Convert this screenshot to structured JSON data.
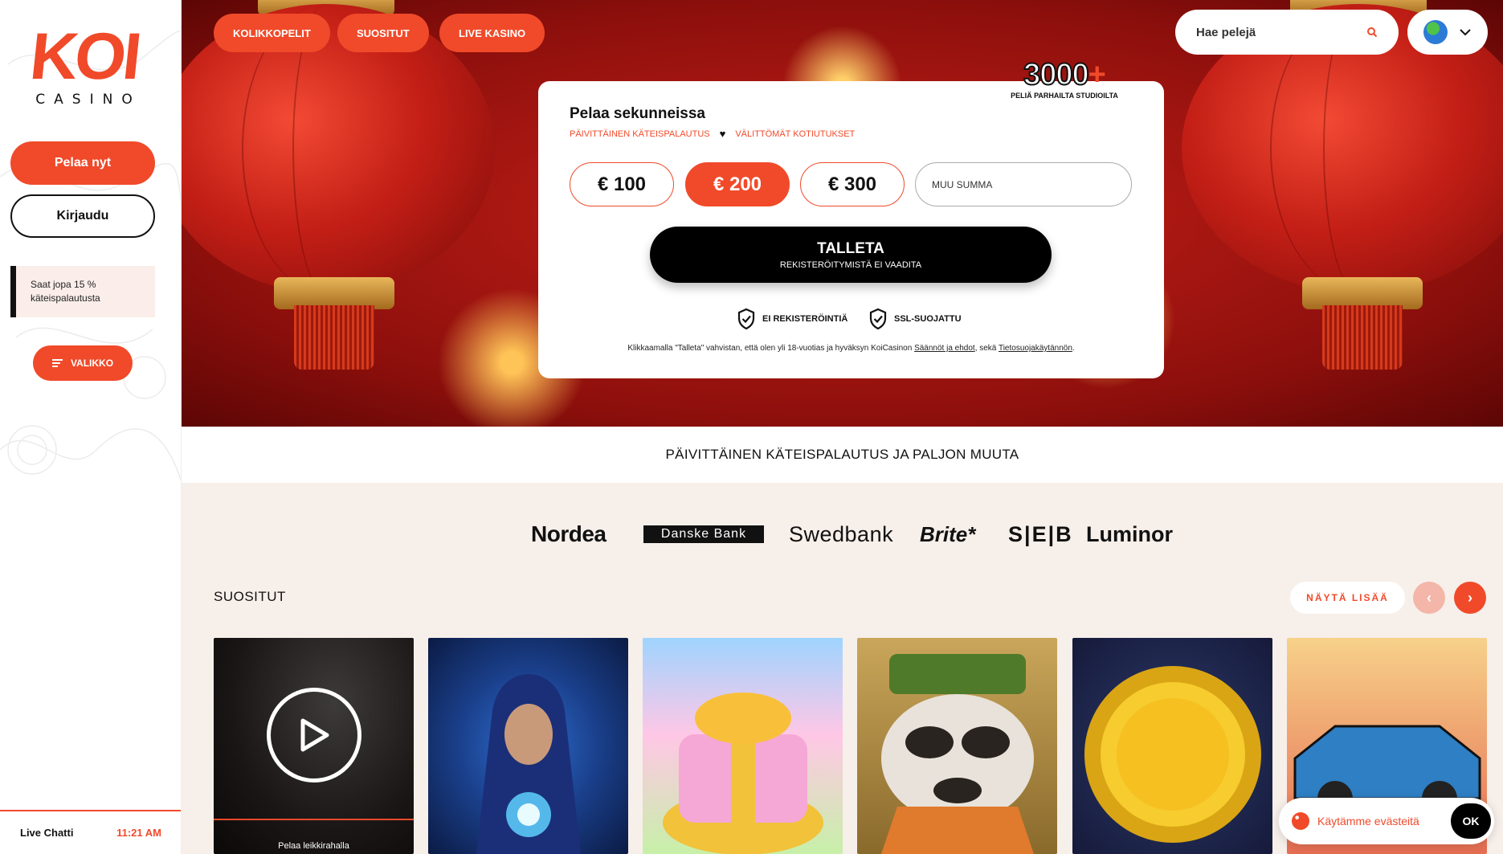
{
  "brand": {
    "logo_main": "KOI",
    "logo_sub": "CASINO"
  },
  "sidebar": {
    "play_now": "Pelaa nyt",
    "login": "Kirjaudu",
    "promo": "Saat jopa 15 % käteispalautusta",
    "menu": "VALIKKO",
    "live_chat": "Live Chatti",
    "time": "11:21 AM"
  },
  "nav": {
    "items": [
      "KOLIKKOPELIT",
      "SUOSITUT",
      "LIVE KASINO"
    ],
    "search_placeholder": "Hae pelejä"
  },
  "badge": {
    "count": "3000",
    "plus": "+",
    "subtitle": "PELIÄ PARHAILTA STUDIOILTA"
  },
  "deposit": {
    "title": "Pelaa sekunneissa",
    "perk1": "PÄIVITTÄINEN KÄTEISPALAUTUS",
    "perk2": "VÄLITTÖMÄT KOTIUTUKSET",
    "amounts": [
      "€ 100",
      "€ 200",
      "€ 300"
    ],
    "selected": "€ 200",
    "other_placeholder": "MUU SUMMA",
    "button_main": "TALLETA",
    "button_sub": "REKISTERÖITYMISTÄ EI VAADITA",
    "trust1": "EI REKISTERÖINTIÄ",
    "trust2": "SSL-SUOJATTU",
    "legal_prefix": "Klikkaamalla \"Talleta\" vahvistan, että olen yli 18-vuotias ja hyväksyn KoiCasinon ",
    "legal_terms": "Säännöt ja ehdot",
    "legal_mid": ", sekä ",
    "legal_privacy": "Tietosuojakäytännön",
    "legal_end": "."
  },
  "strip": {
    "text": "PÄIVITTÄINEN KÄTEISPALAUTUS JA PALJON MUUTA"
  },
  "banks": [
    "Nordea",
    "Danske Bank",
    "Swedbank",
    "Brite*",
    "S|E|B",
    "Luminor"
  ],
  "popular": {
    "title": "SUOSITUT",
    "more": "NÄYTÄ LISÄÄ",
    "demo_label": "Pelaa leikkirahalla"
  },
  "cookie": {
    "text": "Käytämme evästeitä",
    "ok": "OK"
  },
  "colors": {
    "accent": "#f04a2a",
    "dark": "#000000",
    "bg": "#f7efea"
  }
}
